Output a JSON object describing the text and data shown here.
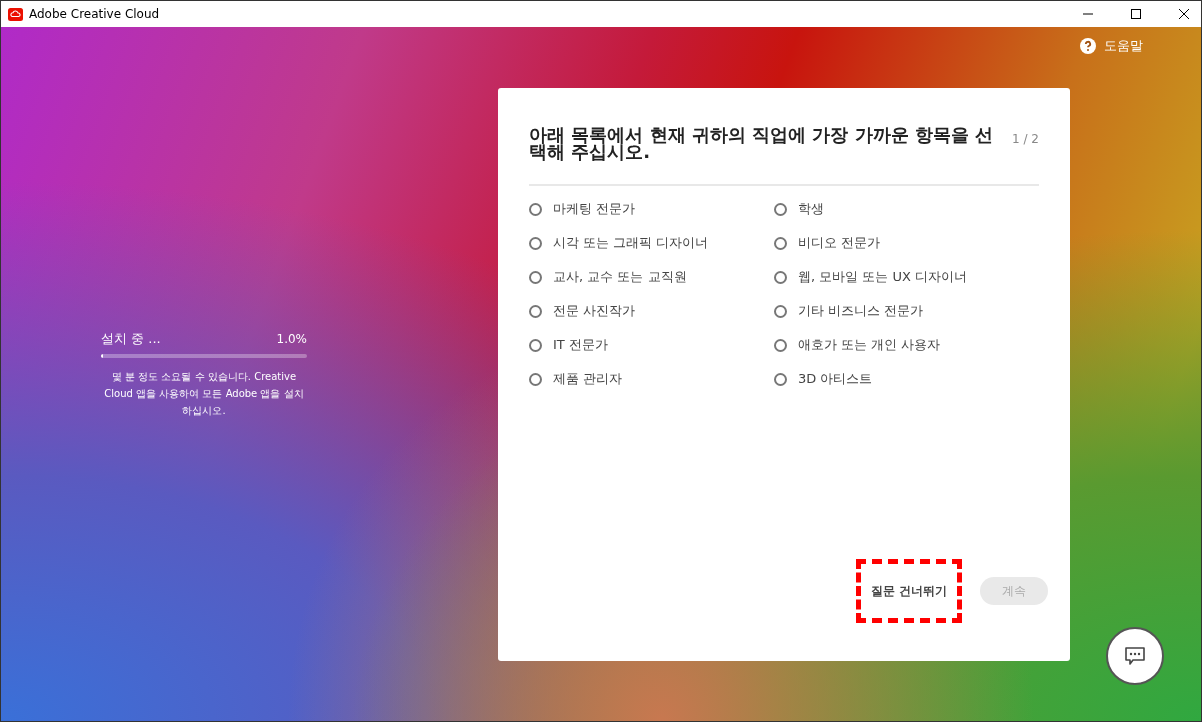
{
  "window": {
    "title": "Adobe Creative Cloud"
  },
  "help": {
    "label": "도움말"
  },
  "install": {
    "label": "설치 중 ...",
    "percent": "1.0%",
    "level": 0.01,
    "note": "몇 분 정도 소요될 수 있습니다. Creative Cloud 앱을 사용하여 모든 Adobe 앱을 설치하십시오."
  },
  "survey": {
    "question": "아래 목록에서 현재 귀하의 직업에 가장 가까운 항목을 선택해 주십시오.",
    "step": "1 / 2",
    "options": [
      {
        "label": "마케팅 전문가",
        "selected": false
      },
      {
        "label": "학생",
        "selected": false
      },
      {
        "label": "시각 또는 그래픽 디자이너",
        "selected": false
      },
      {
        "label": "비디오 전문가",
        "selected": false
      },
      {
        "label": "교사, 교수 또는 교직원",
        "selected": false
      },
      {
        "label": "웹, 모바일 또는 UX 디자이너",
        "selected": false
      },
      {
        "label": "전문 사진작가",
        "selected": false
      },
      {
        "label": "기타 비즈니스 전문가",
        "selected": false
      },
      {
        "label": "IT 전문가",
        "selected": false
      },
      {
        "label": "애호가 또는 개인 사용자",
        "selected": false
      },
      {
        "label": "제품 관리자",
        "selected": false
      },
      {
        "label": "3D 아티스트",
        "selected": false
      }
    ],
    "buttons": [
      {
        "label": "질문 건너뛰기",
        "kind": "text",
        "disabled": false,
        "highlighted": true
      },
      {
        "label": "계속",
        "kind": "filled",
        "disabled": true,
        "highlighted": false
      }
    ]
  }
}
